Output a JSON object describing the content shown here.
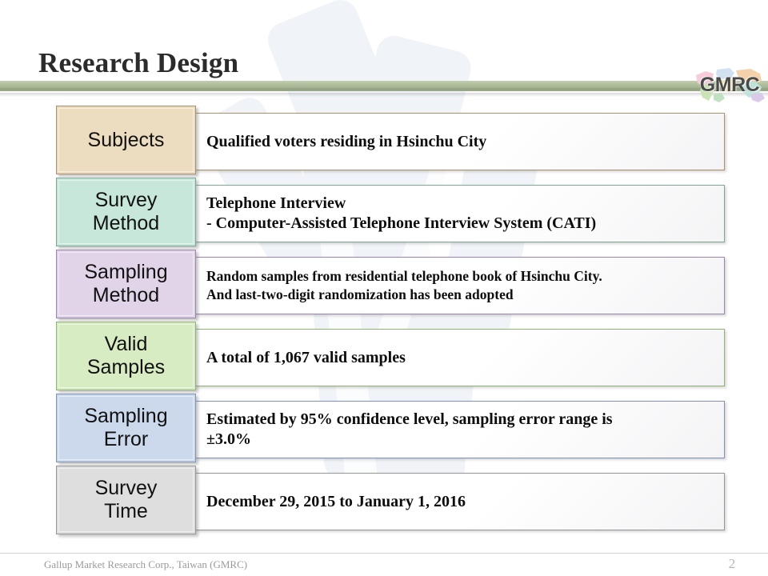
{
  "slide": {
    "title": "Research Design",
    "page_number": "2",
    "footer": "Gallup Market Research Corp., Taiwan (GMRC)",
    "logo_text": "GMRC",
    "logo_name": "gmrc-globe-logo"
  },
  "theme": {
    "divider_color": "#a7b695",
    "title_color": "#2b2b2b",
    "footer_color": "#9a9a9a",
    "panel_background": "#ffffff"
  },
  "rows": [
    {
      "label": "Subjects",
      "content": "Qualified voters residing in Hsinchu City",
      "box_color": "#ecddc0",
      "border_color": "#a79170",
      "small": false
    },
    {
      "label": "Survey\nMethod",
      "content": "Telephone Interview\n- Computer-Assisted Telephone Interview System (CATI)",
      "box_color": "#c6e7da",
      "border_color": "#7fa695",
      "small": false
    },
    {
      "label": "Sampling\nMethod",
      "content": "Random samples from residential telephone book of Hsinchu City.\nAnd last-two-digit randomization has been adopted",
      "box_color": "#e2d4e8",
      "border_color": "#9b86ab",
      "small": true
    },
    {
      "label": "Valid\nSamples",
      "content": "A total of 1,067 valid samples",
      "box_color": "#d8ecc3",
      "border_color": "#93b277",
      "small": false
    },
    {
      "label": "Sampling\nError",
      "content": "Estimated by 95% confidence level, sampling error range is\n±3.0%",
      "box_color": "#ccd8ec",
      "border_color": "#8093b5",
      "small": false
    },
    {
      "label": "Survey\nTime",
      "content": "December 29, 2015 to January 1, 2016",
      "box_color": "#dedede",
      "border_color": "#969696",
      "small": false
    }
  ]
}
